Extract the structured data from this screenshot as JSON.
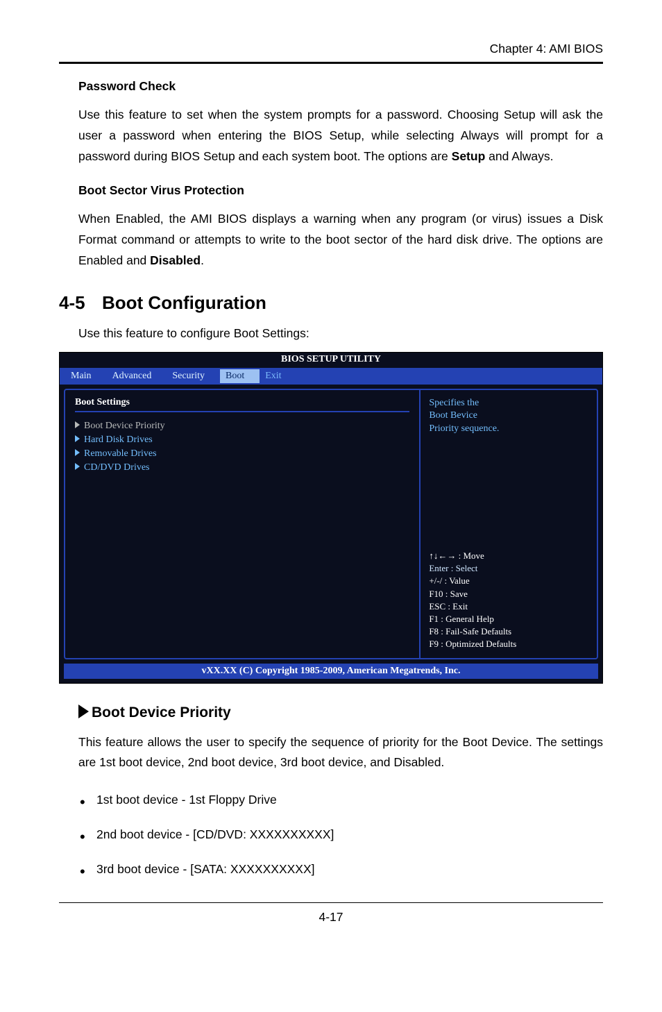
{
  "header": {
    "chapter": "Chapter 4: AMI BIOS"
  },
  "sec1": {
    "heading": "Password Check",
    "para_parts": {
      "pre": "Use this feature to set when the system prompts for a password.  Choosing Setup will ask the user a password when entering the BIOS Setup, while selecting Always will prompt for a password during BIOS Setup and each system boot.  The options are ",
      "bold": "Setup",
      "post": " and Always."
    }
  },
  "sec2": {
    "heading": "Boot Sector Virus Protection",
    "para_parts": {
      "pre": "When Enabled, the AMI BIOS displays a warning when any program (or virus) issues a Disk Format command or attempts to write to the boot sector of the hard disk drive. The options are Enabled and ",
      "bold": "Disabled",
      "post": "."
    }
  },
  "h2": {
    "num": "4-5",
    "title": "Boot Configuration"
  },
  "intro": "Use this feature to configure Boot Settings:",
  "bios": {
    "title": "BIOS SETUP UTILITY",
    "tabs": {
      "main": "Main",
      "advanced": "Advanced",
      "security": "Security",
      "boot": "Boot",
      "exit": "Exit"
    },
    "left_title": "Boot Settings",
    "items": {
      "sel": "Boot Device Priority",
      "hdd": "Hard Disk Drives",
      "rem": "Removable Drives",
      "cd": "CD/DVD Drives"
    },
    "help": {
      "l1": "Specifies the",
      "l2": "Boot Bevice",
      "l3": "Priority sequence."
    },
    "hints": {
      "move": "↑↓←→ : Move",
      "enter": "Enter : Select",
      "value": "+/-/ : Value",
      "save": "F10 : Save",
      "esc": "ESC : Exit",
      "f1": "F1 : General Help",
      "f8": "F8 : Fail-Safe Defaults",
      "f9": "F9 : Optimized Defaults"
    },
    "footer": "vXX.XX (C) Copyright 1985-2009, American Megatrends, Inc."
  },
  "sub": {
    "heading": "Boot Device Priority"
  },
  "sub_para": "This feature allows the user to specify the sequence of priority for the Boot Device. The settings are 1st boot device, 2nd boot device, 3rd boot device, and Disabled.",
  "list": {
    "i1": "1st boot device - 1st Floppy Drive",
    "i2": "2nd boot device - [CD/DVD: XXXXXXXXXX]",
    "i3": "3rd boot device - [SATA: XXXXXXXXXX]"
  },
  "pagenum": "4-17"
}
